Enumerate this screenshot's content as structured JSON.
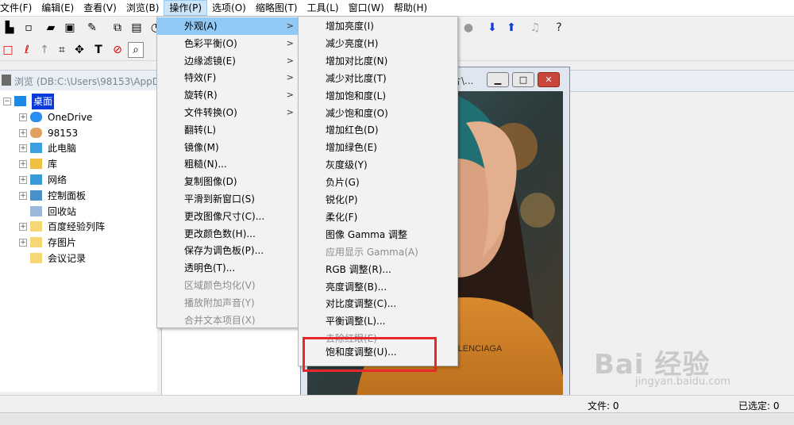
{
  "menubar": {
    "items": [
      "文件(F)",
      "编辑(E)",
      "查看(V)",
      "浏览(B)",
      "操作(P)",
      "选项(O)",
      "缩略图(T)",
      "工具(L)",
      "窗口(W)",
      "帮助(H)"
    ],
    "active": "操作(P)"
  },
  "browse": {
    "title": "浏览 (DB:C:\\Users\\98153\\AppDa"
  },
  "tree": {
    "items": [
      {
        "label": "桌面",
        "level": 0,
        "expander": "−",
        "icon": "desktop-icon"
      },
      {
        "label": "OneDrive",
        "level": 1,
        "expander": "+",
        "icon": "cloud-icon"
      },
      {
        "label": "98153",
        "level": 1,
        "expander": "+",
        "icon": "user-icon"
      },
      {
        "label": "此电脑",
        "level": 1,
        "expander": "+",
        "icon": "computer-icon"
      },
      {
        "label": "库",
        "level": 1,
        "expander": "+",
        "icon": "library-icon"
      },
      {
        "label": "网络",
        "level": 1,
        "expander": "+",
        "icon": "network-icon"
      },
      {
        "label": "控制面板",
        "level": 1,
        "expander": "+",
        "icon": "control-panel-icon"
      },
      {
        "label": "回收站",
        "level": 1,
        "expander": "",
        "icon": "recycle-bin-icon"
      },
      {
        "label": "百度经验列阵",
        "level": 1,
        "expander": "+",
        "icon": "folder-icon"
      },
      {
        "label": "存图片",
        "level": 1,
        "expander": "+",
        "icon": "folder-icon"
      },
      {
        "label": "会议记录",
        "level": 1,
        "expander": "",
        "icon": "folder-icon"
      }
    ]
  },
  "image_window": {
    "title": "片\\..."
  },
  "operate_menu": {
    "items": [
      {
        "label": "外观(A)",
        "submenu": true,
        "highlighted": true,
        "disabled": false
      },
      {
        "label": "色彩平衡(O)",
        "submenu": true,
        "highlighted": false,
        "disabled": false
      },
      {
        "label": "边缘滤镜(E)",
        "submenu": true,
        "highlighted": false,
        "disabled": false
      },
      {
        "label": "特效(F)",
        "submenu": true,
        "highlighted": false,
        "disabled": false
      },
      {
        "label": "旋转(R)",
        "submenu": true,
        "highlighted": false,
        "disabled": false
      },
      {
        "label": "文件转换(O)",
        "submenu": true,
        "highlighted": false,
        "disabled": false
      },
      {
        "label": "翻转(L)",
        "submenu": false,
        "highlighted": false,
        "disabled": false
      },
      {
        "label": "镜像(M)",
        "submenu": false,
        "highlighted": false,
        "disabled": false
      },
      {
        "label": "粗糙(N)...",
        "submenu": false,
        "highlighted": false,
        "disabled": false
      },
      {
        "label": "复制图像(D)",
        "submenu": false,
        "highlighted": false,
        "disabled": false
      },
      {
        "label": "平滑到新窗口(S)",
        "submenu": false,
        "highlighted": false,
        "disabled": false
      },
      {
        "label": "更改图像尺寸(C)...",
        "submenu": false,
        "highlighted": false,
        "disabled": false
      },
      {
        "label": "更改颜色数(H)...",
        "submenu": false,
        "highlighted": false,
        "disabled": false
      },
      {
        "label": "保存为调色板(P)...",
        "submenu": false,
        "highlighted": false,
        "disabled": false
      },
      {
        "label": "透明色(T)...",
        "submenu": false,
        "highlighted": false,
        "disabled": false
      },
      {
        "label": "区域颜色均化(V)",
        "submenu": false,
        "highlighted": false,
        "disabled": true
      },
      {
        "label": "播放附加声音(Y)",
        "submenu": false,
        "highlighted": false,
        "disabled": true
      },
      {
        "label": "合并文本项目(X)",
        "submenu": false,
        "highlighted": false,
        "disabled": true
      }
    ]
  },
  "appearance_menu": {
    "items": [
      {
        "label": "增加亮度(I)",
        "disabled": false
      },
      {
        "label": "减少亮度(H)",
        "disabled": false
      },
      {
        "label": "增加对比度(N)",
        "disabled": false
      },
      {
        "label": "减少对比度(T)",
        "disabled": false
      },
      {
        "label": "增加饱和度(L)",
        "disabled": false
      },
      {
        "label": "减少饱和度(O)",
        "disabled": false
      },
      {
        "label": "增加红色(D)",
        "disabled": false
      },
      {
        "label": "增加绿色(E)",
        "disabled": false
      },
      {
        "label": "灰度级(Y)",
        "disabled": false
      },
      {
        "label": "负片(G)",
        "disabled": false
      },
      {
        "label": "锐化(P)",
        "disabled": false
      },
      {
        "label": "柔化(F)",
        "disabled": false
      },
      {
        "label": "图像 Gamma 调整",
        "disabled": false
      },
      {
        "label": "应用显示 Gamma(A)",
        "disabled": true
      },
      {
        "label": "RGB 调整(R)...",
        "disabled": false
      },
      {
        "label": "亮度调整(B)...",
        "disabled": false
      },
      {
        "label": "对比度调整(C)...",
        "disabled": false
      },
      {
        "label": "平衡调整(L)...",
        "disabled": false
      },
      {
        "label": "去除红眼(E)",
        "disabled": true
      },
      {
        "label": "饱和度调整(U)...",
        "disabled": false
      }
    ],
    "annotated_item": "饱和度调整(U)..."
  },
  "statusbar": {
    "files": "文件: 0",
    "selected": "已选定: 0"
  },
  "watermark": {
    "text": "Bai 经验",
    "url": "jingyan.baidu.com"
  },
  "colors": {
    "highlight": "#91c9f7",
    "annotation_red": "#e8272b",
    "menu_bg": "#f2f2f2"
  }
}
